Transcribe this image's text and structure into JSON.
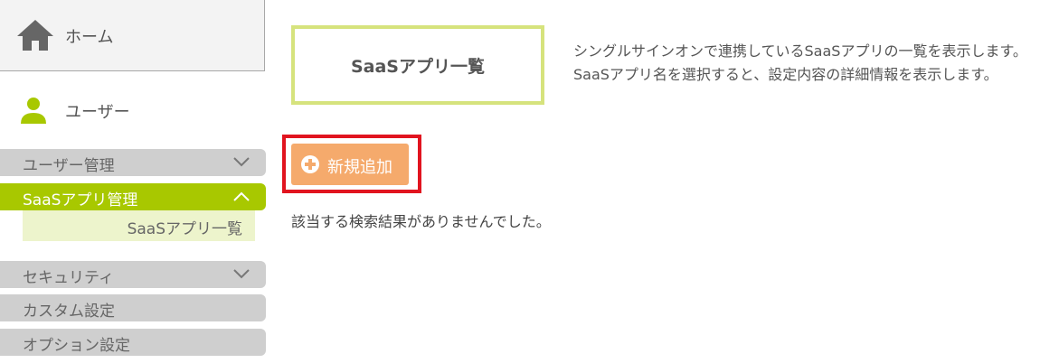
{
  "sidebar": {
    "home": {
      "label": "ホーム",
      "icon": "home-icon"
    },
    "user_section": {
      "label": "ユーザー",
      "icon": "user-icon",
      "icon_color": "#a8c800"
    },
    "menu": [
      {
        "label": "ユーザー管理",
        "state": "collapsed"
      },
      {
        "label": "SaaSアプリ管理",
        "state": "expanded",
        "active": true
      },
      {
        "label": "セキュリティ",
        "state": "collapsed"
      },
      {
        "label": "カスタム設定"
      },
      {
        "label": "オプション設定"
      }
    ],
    "submenu": [
      {
        "label": "SaaSアプリ一覧"
      }
    ]
  },
  "main": {
    "title": "SaaSアプリ一覧",
    "description_line1": "シングルサインオンで連携しているSaaSアプリの一覧を表示します。",
    "description_line2": "SaaSアプリ名を選択すると、設定内容の詳細情報を表示します。",
    "add_button_label": "新規追加",
    "empty_message": "該当する検索結果がありませんでした。"
  },
  "colors": {
    "accent": "#a8c800",
    "title_border": "#d6e37d",
    "add_button": "#f5aa6c",
    "highlight": "#e1141f"
  }
}
